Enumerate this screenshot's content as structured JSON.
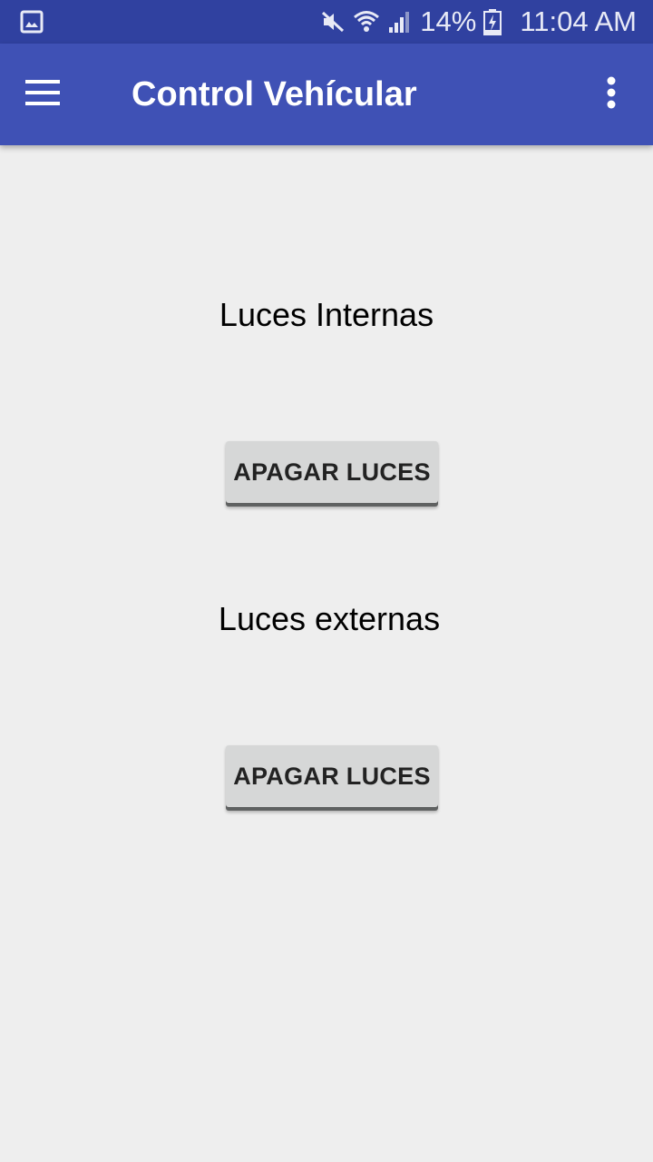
{
  "status_bar": {
    "battery_percent": "14%",
    "time": "11:04 AM",
    "icons": [
      "gallery-notification-icon",
      "mute-icon",
      "wifi-icon",
      "cellular-signal-icon",
      "battery-charging-icon"
    ]
  },
  "app_bar": {
    "title": "Control Vehícular",
    "background_color": "#3f51b5",
    "status_bar_color": "#3041a0",
    "icons": [
      "hamburger-menu-icon",
      "overflow-menu-icon"
    ]
  },
  "main": {
    "sections": [
      {
        "label": "Luces Internas",
        "button_label": "APAGAR LUCES"
      },
      {
        "label": "Luces externas",
        "button_label": "APAGAR LUCES"
      }
    ]
  }
}
